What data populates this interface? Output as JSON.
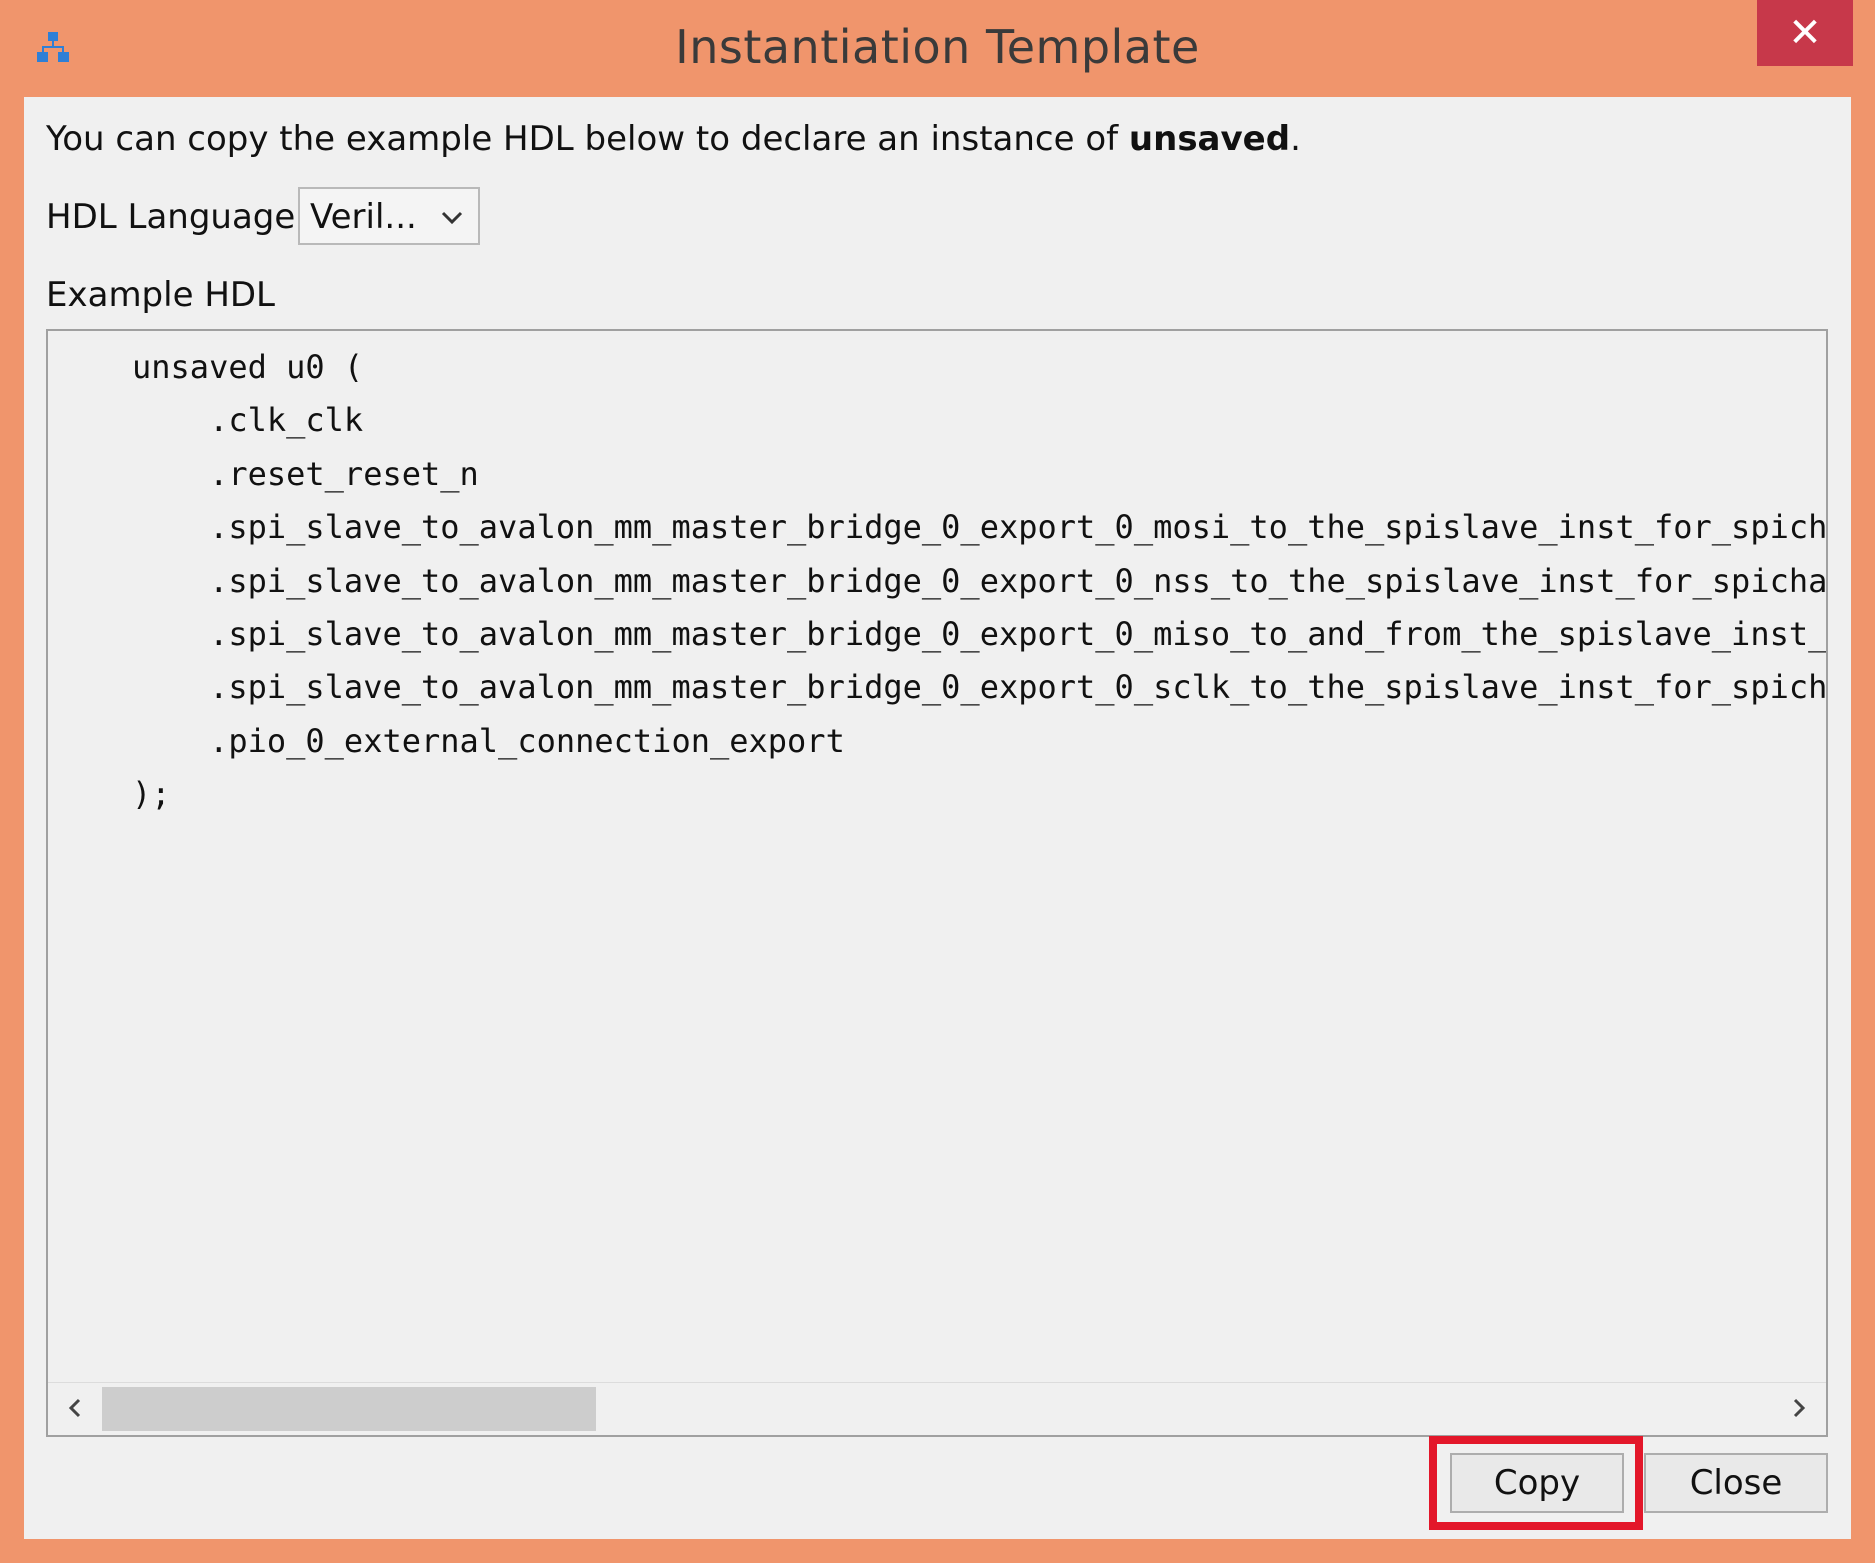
{
  "window": {
    "title": "Instantiation Template",
    "close_icon": "close-icon",
    "app_icon": "network-icon"
  },
  "intro": {
    "prefix": "You can copy the example HDL below to declare an instance of ",
    "entity": "unsaved",
    "suffix": "."
  },
  "hdl_language": {
    "label": "HDL Language:",
    "selected": "Veril..."
  },
  "example": {
    "label": "Example HDL",
    "lines": [
      "unsaved u0 (",
      "    .clk_clk",
      "    .reset_reset_n",
      "    .spi_slave_to_avalon_mm_master_bridge_0_export_0_mosi_to_the_spislave_inst_for_spichain",
      "    .spi_slave_to_avalon_mm_master_bridge_0_export_0_nss_to_the_spislave_inst_for_spichain",
      "    .spi_slave_to_avalon_mm_master_bridge_0_export_0_miso_to_and_from_the_spislave_inst_for_spichain",
      "    .spi_slave_to_avalon_mm_master_bridge_0_export_0_sclk_to_the_spislave_inst_for_spichain",
      "    .pio_0_external_connection_export",
      ");"
    ]
  },
  "buttons": {
    "copy": "Copy",
    "close": "Close"
  },
  "colors": {
    "title_bar": "#f0956c",
    "close_button": "#c7384a",
    "highlight": "#e3172a"
  }
}
